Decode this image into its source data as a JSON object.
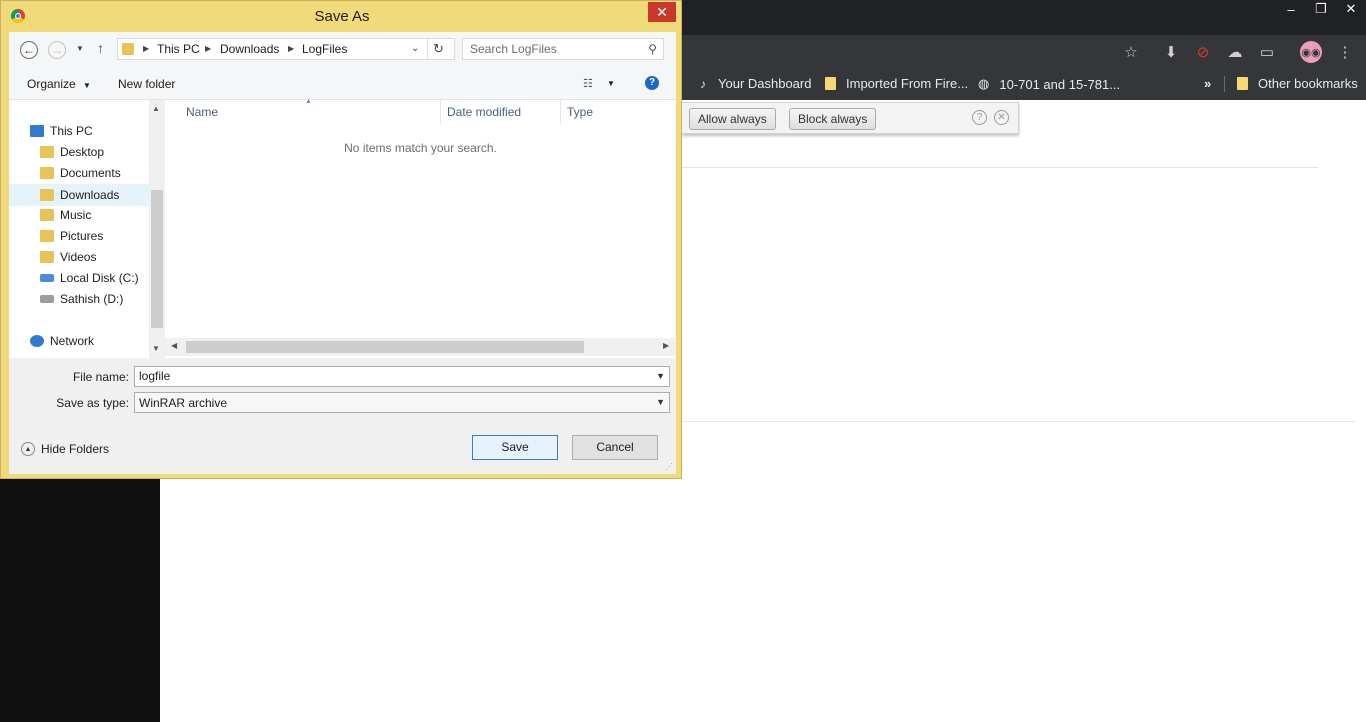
{
  "browser": {
    "bookmarks": [
      {
        "label": "Your Dashboard",
        "icon": "guitar-icon"
      },
      {
        "label": "Imported From Fire...",
        "icon": "folder-icon"
      },
      {
        "label": "10-701 and 15-781...",
        "icon": "globe-icon"
      }
    ],
    "overflow_label": "»",
    "other_bookmarks": "Other bookmarks",
    "infobar": {
      "allow_label": "Allow always",
      "block_label": "Block always"
    },
    "window_controls": {
      "minimize": "–",
      "restore": "❐",
      "close": "✕"
    }
  },
  "dialog": {
    "title": "Save As",
    "close_glyph": "✕",
    "breadcrumb": [
      "This PC",
      "Downloads",
      "LogFiles"
    ],
    "search_placeholder": "Search LogFiles",
    "organize_label": "Organize",
    "new_folder_label": "New folder",
    "columns": [
      "Name",
      "Date modified",
      "Type"
    ],
    "empty_message": "No items match your search.",
    "tree": [
      {
        "label": "This PC",
        "icon": "this-pc-icon"
      },
      {
        "label": "Desktop",
        "icon": "folder-icon"
      },
      {
        "label": "Documents",
        "icon": "folder-icon"
      },
      {
        "label": "Downloads",
        "icon": "folder-icon",
        "selected": true
      },
      {
        "label": "Music",
        "icon": "folder-icon"
      },
      {
        "label": "Pictures",
        "icon": "folder-icon"
      },
      {
        "label": "Videos",
        "icon": "folder-icon"
      },
      {
        "label": "Local Disk (C:)",
        "icon": "drive-icon"
      },
      {
        "label": "Sathish (D:)",
        "icon": "drive-icon"
      },
      {
        "label": "Network",
        "icon": "network-icon"
      }
    ],
    "file_name_label": "File name:",
    "file_name_value": "logfile",
    "save_type_label": "Save as type:",
    "save_type_value": "WinRAR archive",
    "hide_folders_label": "Hide Folders",
    "save_label": "Save",
    "cancel_label": "Cancel"
  },
  "colors": {
    "dialog_frame": "#f0da7a",
    "close_button": "#c7392b",
    "selection": "#e5f3fb",
    "browser_dark": "#35363a"
  }
}
